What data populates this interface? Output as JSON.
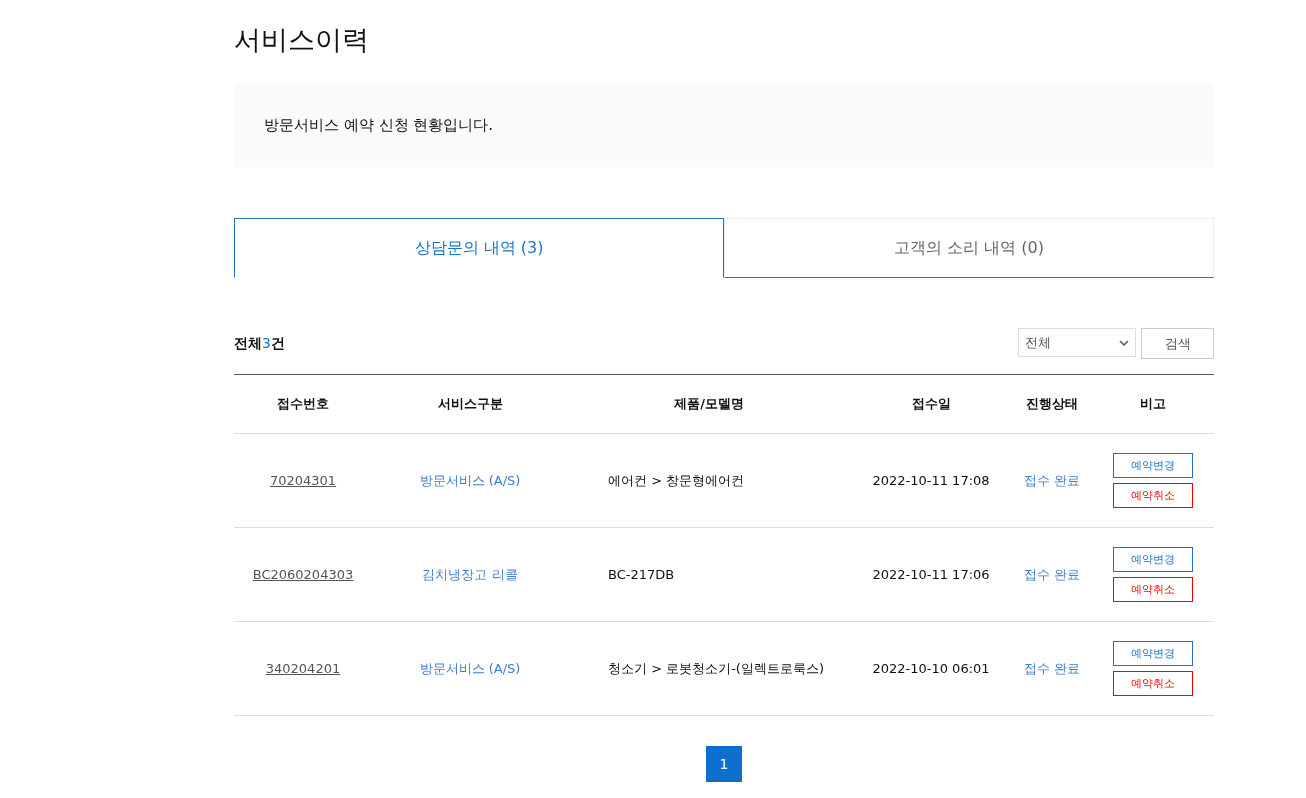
{
  "page_title": "서비스이력",
  "notice": "방문서비스 예약 신청 현황입니다.",
  "tabs": [
    {
      "label": "상담문의 내역 (3)",
      "selected": true
    },
    {
      "label": "고객의 소리 내역 (0)",
      "selected": false
    }
  ],
  "summary": {
    "prefix": "전체",
    "count": "3",
    "suffix": "건"
  },
  "filter": {
    "value": "전체"
  },
  "search_button": "검색",
  "table": {
    "columns": [
      "접수번호",
      "서비스구분",
      "제품/모델명",
      "접수일",
      "진행상태",
      "비고"
    ],
    "rows": [
      {
        "number": "70204301",
        "service": "방문서비스 (A/S)",
        "product": "에어컨 > 창문형에어컨",
        "date": "2022-10-11 17:08",
        "status": "접수 완료",
        "actions": [
          "예약변경",
          "예약취소"
        ]
      },
      {
        "number": "BC2060204303",
        "service": "김치냉장고 리콜",
        "product": "BC-217DB",
        "date": "2022-10-11 17:06",
        "status": "접수 완료",
        "actions": [
          "예약변경",
          "예약취소"
        ]
      },
      {
        "number": "340204201",
        "service": "방문서비스 (A/S)",
        "product": "청소기 > 로봇청소기-(일렉트로룩스)",
        "date": "2022-10-10 06:01",
        "status": "접수 완료",
        "actions": [
          "예약변경",
          "예약취소"
        ]
      }
    ]
  },
  "pagination": [
    {
      "label": "1",
      "selected": true
    }
  ]
}
